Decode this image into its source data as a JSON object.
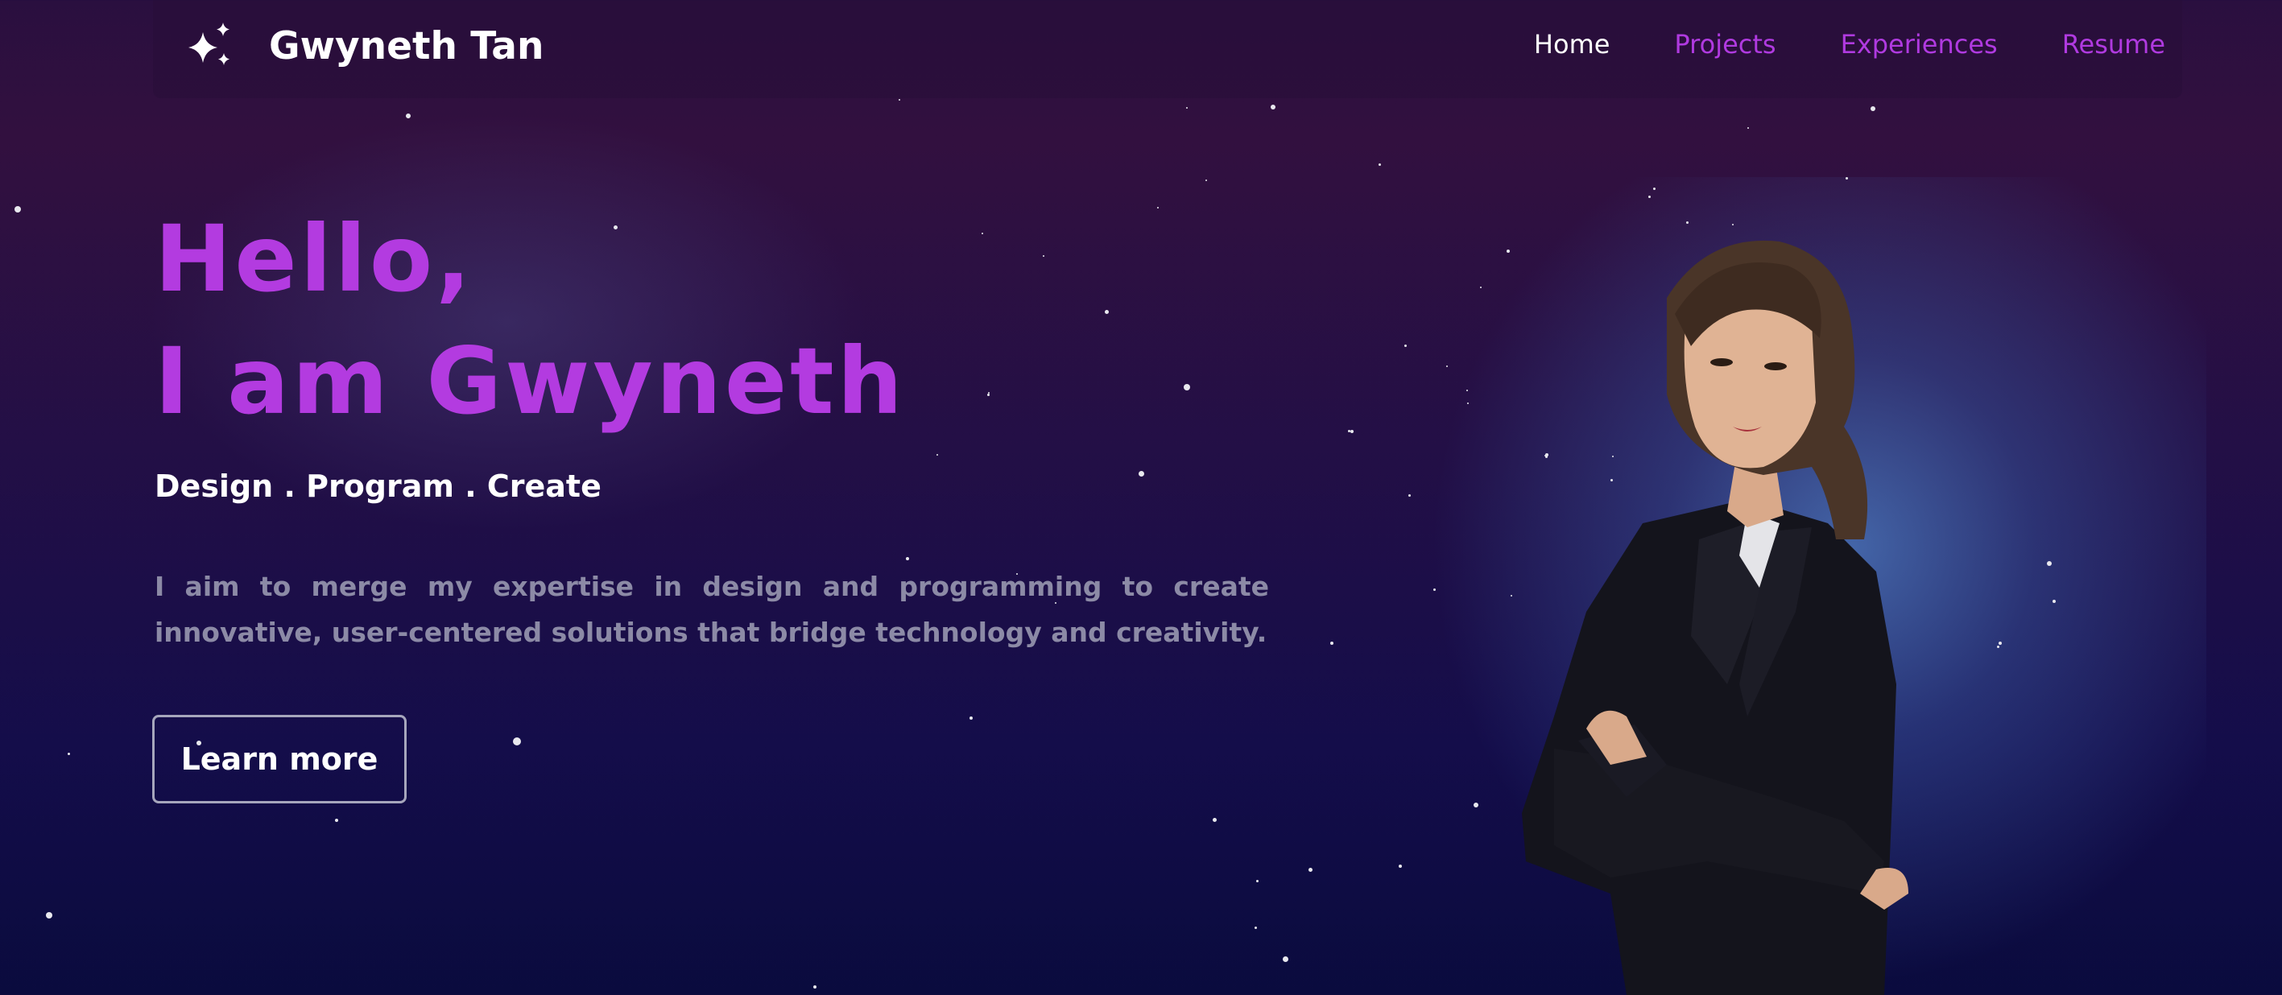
{
  "brand": {
    "name": "Gwyneth Tan",
    "icon": "sparkles-icon"
  },
  "nav": {
    "links": [
      {
        "label": "Home",
        "active": true
      },
      {
        "label": "Projects",
        "active": false
      },
      {
        "label": "Experiences",
        "active": false
      },
      {
        "label": "Resume",
        "active": false
      }
    ]
  },
  "hero": {
    "greeting_line1": "Hello,",
    "greeting_line2": "I am Gwyneth",
    "tagline": "Design . Program . Create",
    "description": "I aim to merge my expertise in design and programming to create innovative, user-centered solutions that bridge technology and creativity.",
    "cta_label": "Learn more"
  },
  "colors": {
    "accent": "#b33be0",
    "nav_link": "#b03ae0",
    "text_primary": "#ffffff",
    "text_muted": "#8c8aa6",
    "background_top": "#2a0f3f",
    "background_bottom": "#0a0b3e"
  }
}
